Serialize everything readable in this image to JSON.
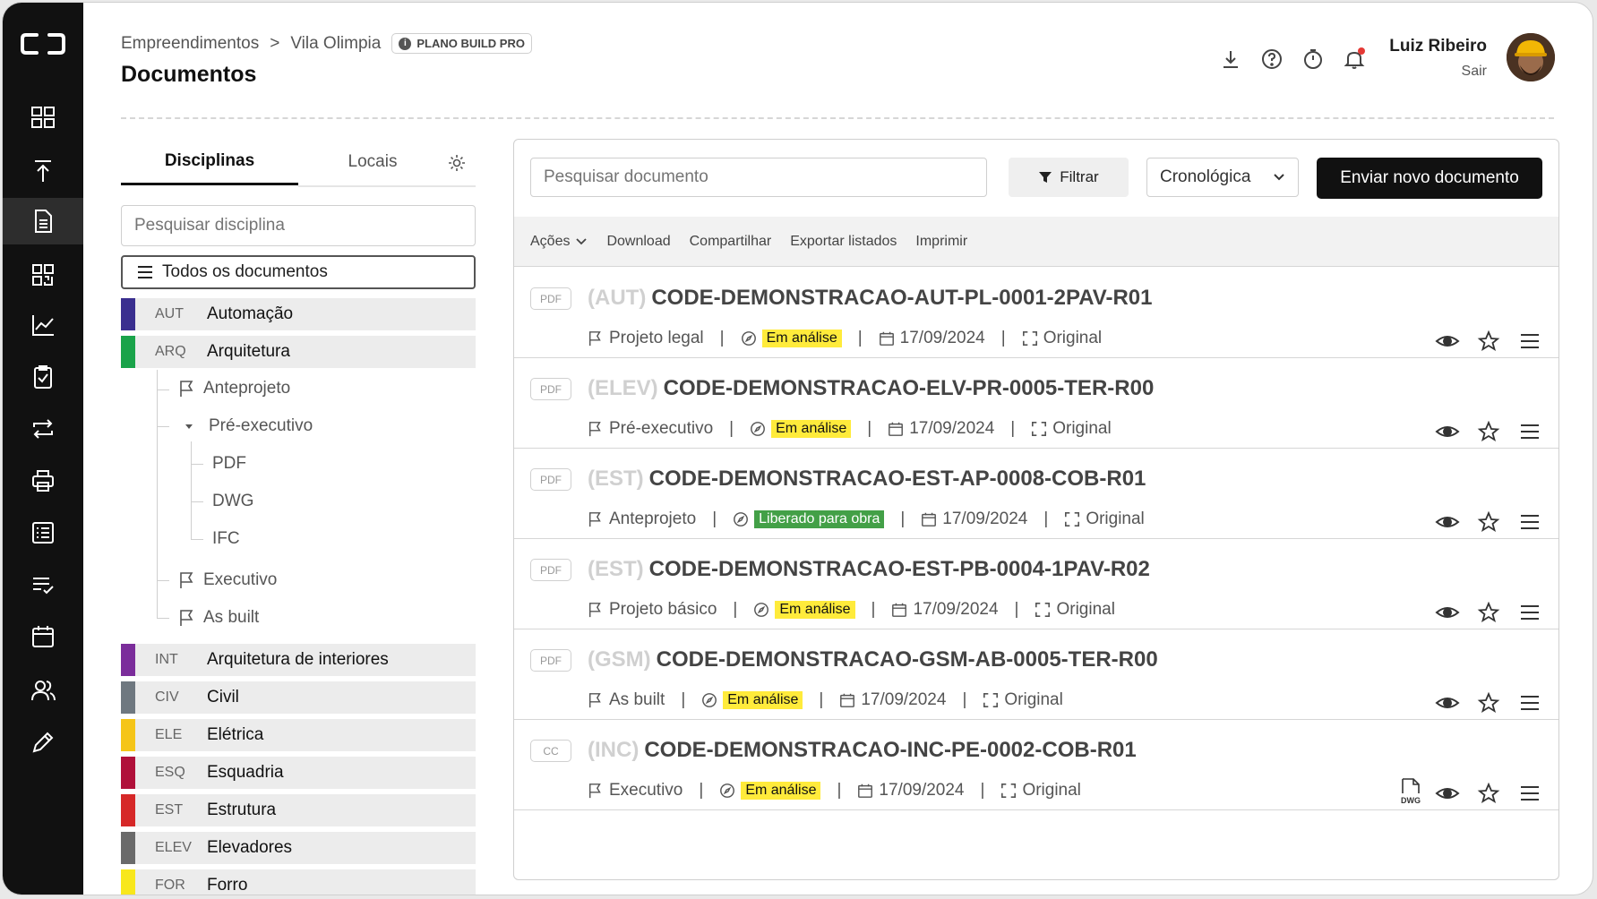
{
  "header": {
    "breadcrumb": [
      "Empreendimentos",
      "Vila Olimpia"
    ],
    "breadcrumb_sep": ">",
    "plan_badge": "PLANO BUILD PRO",
    "page_title": "Documentos",
    "user_name": "Luiz Ribeiro",
    "logout": "Sair"
  },
  "left": {
    "tabs": [
      "Disciplinas",
      "Locais"
    ],
    "search_placeholder": "Pesquisar disciplina",
    "all_docs": "Todos os documentos",
    "disciplines": [
      {
        "code": "AUT",
        "name": "Automação",
        "color": "#3a2f8f"
      },
      {
        "code": "ARQ",
        "name": "Arquitetura",
        "color": "#1aa34a"
      },
      {
        "code": "INT",
        "name": "Arquitetura de interiores",
        "color": "#7b2d9b"
      },
      {
        "code": "CIV",
        "name": "Civil",
        "color": "#6f7880"
      },
      {
        "code": "ELE",
        "name": "Elétrica",
        "color": "#f5c518"
      },
      {
        "code": "ESQ",
        "name": "Esquadria",
        "color": "#b0103a"
      },
      {
        "code": "EST",
        "name": "Estrutura",
        "color": "#d62828"
      },
      {
        "code": "ELEV",
        "name": "Elevadores",
        "color": "#6a6a6a"
      },
      {
        "code": "FOR",
        "name": "Forro",
        "color": "#f8e71c"
      }
    ],
    "tree": {
      "anteprojeto": "Anteprojeto",
      "pre_executivo": "Pré-executivo",
      "pdf": "PDF",
      "dwg": "DWG",
      "ifc": "IFC",
      "executivo": "Executivo",
      "as_built": "As built"
    }
  },
  "toolbar": {
    "search_placeholder": "Pesquisar documento",
    "filter": "Filtrar",
    "order": "Cronológica",
    "send": "Enviar novo documento"
  },
  "actions": [
    "Ações",
    "Download",
    "Compartilhar",
    "Exportar listados",
    "Imprimir"
  ],
  "documents": [
    {
      "type": "PDF",
      "abbr": "(AUT)",
      "code": "CODE-DEMONSTRACAO-AUT-PL-0001-2PAV-R01",
      "phase": "Projeto legal",
      "status": "Em análise",
      "status_color": "yellow",
      "date": "17/09/2024",
      "version": "Original"
    },
    {
      "type": "PDF",
      "abbr": "(ELEV)",
      "code": "CODE-DEMONSTRACAO-ELV-PR-0005-TER-R00",
      "phase": "Pré-executivo",
      "status": "Em análise",
      "status_color": "yellow",
      "date": "17/09/2024",
      "version": "Original"
    },
    {
      "type": "PDF",
      "abbr": "(EST)",
      "code": "CODE-DEMONSTRACAO-EST-AP-0008-COB-R01",
      "phase": "Anteprojeto",
      "status": "Liberado para obra",
      "status_color": "green",
      "date": "17/09/2024",
      "version": "Original"
    },
    {
      "type": "PDF",
      "abbr": "(EST)",
      "code": "CODE-DEMONSTRACAO-EST-PB-0004-1PAV-R02",
      "phase": "Projeto básico",
      "status": "Em análise",
      "status_color": "yellow",
      "date": "17/09/2024",
      "version": "Original"
    },
    {
      "type": "PDF",
      "abbr": "(GSM)",
      "code": "CODE-DEMONSTRACAO-GSM-AB-0005-TER-R00",
      "phase": "As built",
      "status": "Em análise",
      "status_color": "yellow",
      "date": "17/09/2024",
      "version": "Original"
    },
    {
      "type": "CC",
      "abbr": "(INC)",
      "code": "CODE-DEMONSTRACAO-INC-PE-0002-COB-R01",
      "phase": "Executivo",
      "status": "Em análise",
      "status_color": "yellow",
      "date": "17/09/2024",
      "version": "Original",
      "extra_icon": "DWG"
    }
  ]
}
